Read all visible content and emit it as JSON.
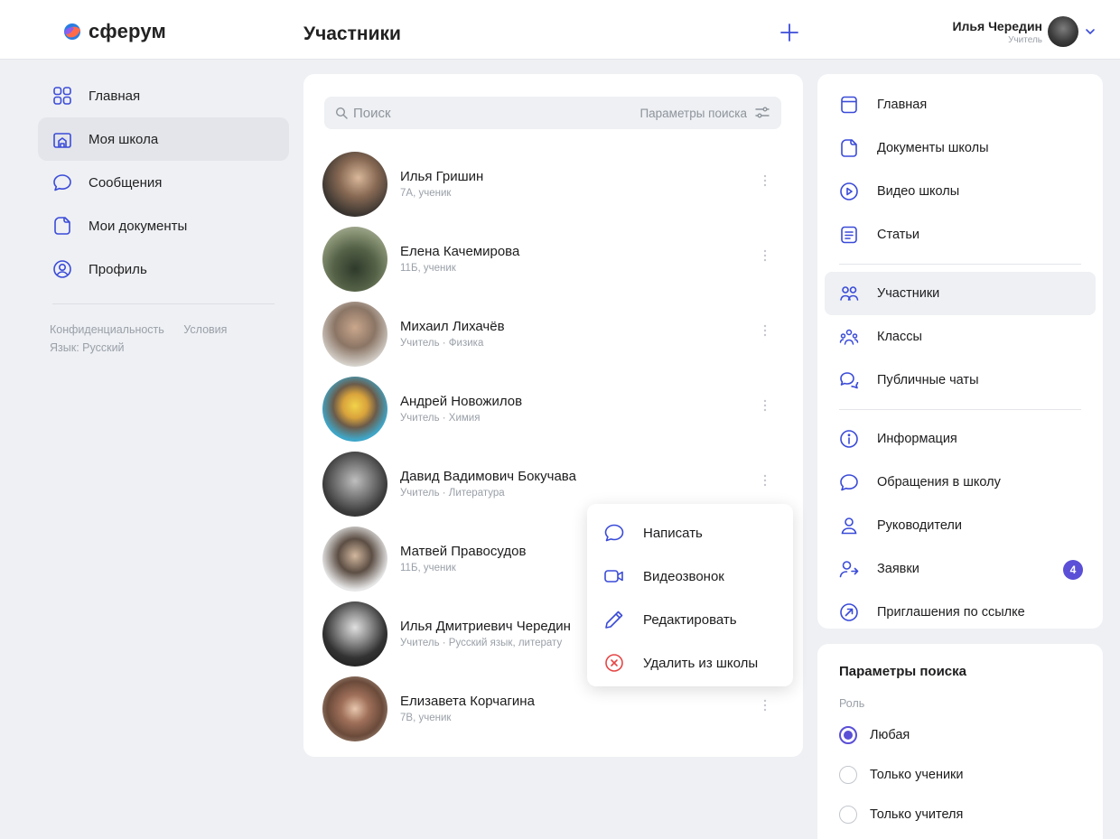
{
  "colors": {
    "accent": "#5a4fd6",
    "danger": "#e64646",
    "icon_blue": "#3a4bd8"
  },
  "header": {
    "logo": "сферум",
    "title": "Участники",
    "user_name": "Илья Чередин",
    "user_role": "Учитель"
  },
  "left_nav": {
    "items": [
      {
        "label": "Главная",
        "icon": "grid-icon"
      },
      {
        "label": "Моя школа",
        "icon": "school-icon",
        "active": true
      },
      {
        "label": "Сообщения",
        "icon": "chat-icon"
      },
      {
        "label": "Мои документы",
        "icon": "document-icon"
      },
      {
        "label": "Профиль",
        "icon": "profile-icon"
      }
    ],
    "footer": {
      "privacy": "Конфиденциальность",
      "terms": "Условия",
      "language": "Язык: Русский"
    }
  },
  "search": {
    "placeholder": "Поиск",
    "params_label": "Параметры поиска"
  },
  "members": [
    {
      "name": "Илья Гришин",
      "subtitle": "7А, ученик"
    },
    {
      "name": "Елена Качемирова",
      "subtitle": "11Б, ученик"
    },
    {
      "name": "Михаил Лихачёв",
      "subtitle": "Учитель · Физика"
    },
    {
      "name": "Андрей Новожилов",
      "subtitle": "Учитель · Химия"
    },
    {
      "name": "Давид Вадимович Бокучава",
      "subtitle": "Учитель · Литература"
    },
    {
      "name": "Матвей Правосудов",
      "subtitle": "11Б, ученик"
    },
    {
      "name": "Илья Дмитриевич Чередин",
      "subtitle": "Учитель · Русский язык, литерату"
    },
    {
      "name": "Елизавета Корчагина",
      "subtitle": "7В, ученик"
    }
  ],
  "context_menu": {
    "items": [
      {
        "label": "Написать",
        "icon": "chat-icon"
      },
      {
        "label": "Видеозвонок",
        "icon": "video-camera-icon"
      },
      {
        "label": "Редактировать",
        "icon": "pencil-icon"
      },
      {
        "label": "Удалить из школы",
        "icon": "remove-circle-icon"
      }
    ]
  },
  "right_menu": {
    "items": [
      {
        "label": "Главная",
        "icon": "home-card-icon"
      },
      {
        "label": "Документы школы",
        "icon": "document-icon"
      },
      {
        "label": "Видео школы",
        "icon": "play-circle-icon"
      },
      {
        "label": "Статьи",
        "icon": "article-icon"
      },
      {
        "label": "Участники",
        "icon": "users-icon",
        "active": true
      },
      {
        "label": "Классы",
        "icon": "classes-icon"
      },
      {
        "label": "Публичные чаты",
        "icon": "public-chats-icon"
      },
      {
        "label": "Информация",
        "icon": "info-icon"
      },
      {
        "label": "Обращения в школу",
        "icon": "chat-icon"
      },
      {
        "label": "Руководители",
        "icon": "person-icon"
      },
      {
        "label": "Заявки",
        "icon": "requests-icon",
        "badge": "4"
      },
      {
        "label": "Приглашения по ссылке",
        "icon": "link-arrow-icon"
      }
    ]
  },
  "search_params": {
    "title": "Параметры поиска",
    "role_label": "Роль",
    "options": [
      {
        "label": "Любая",
        "checked": true
      },
      {
        "label": "Только ученики",
        "checked": false
      },
      {
        "label": "Только учителя",
        "checked": false
      }
    ]
  }
}
